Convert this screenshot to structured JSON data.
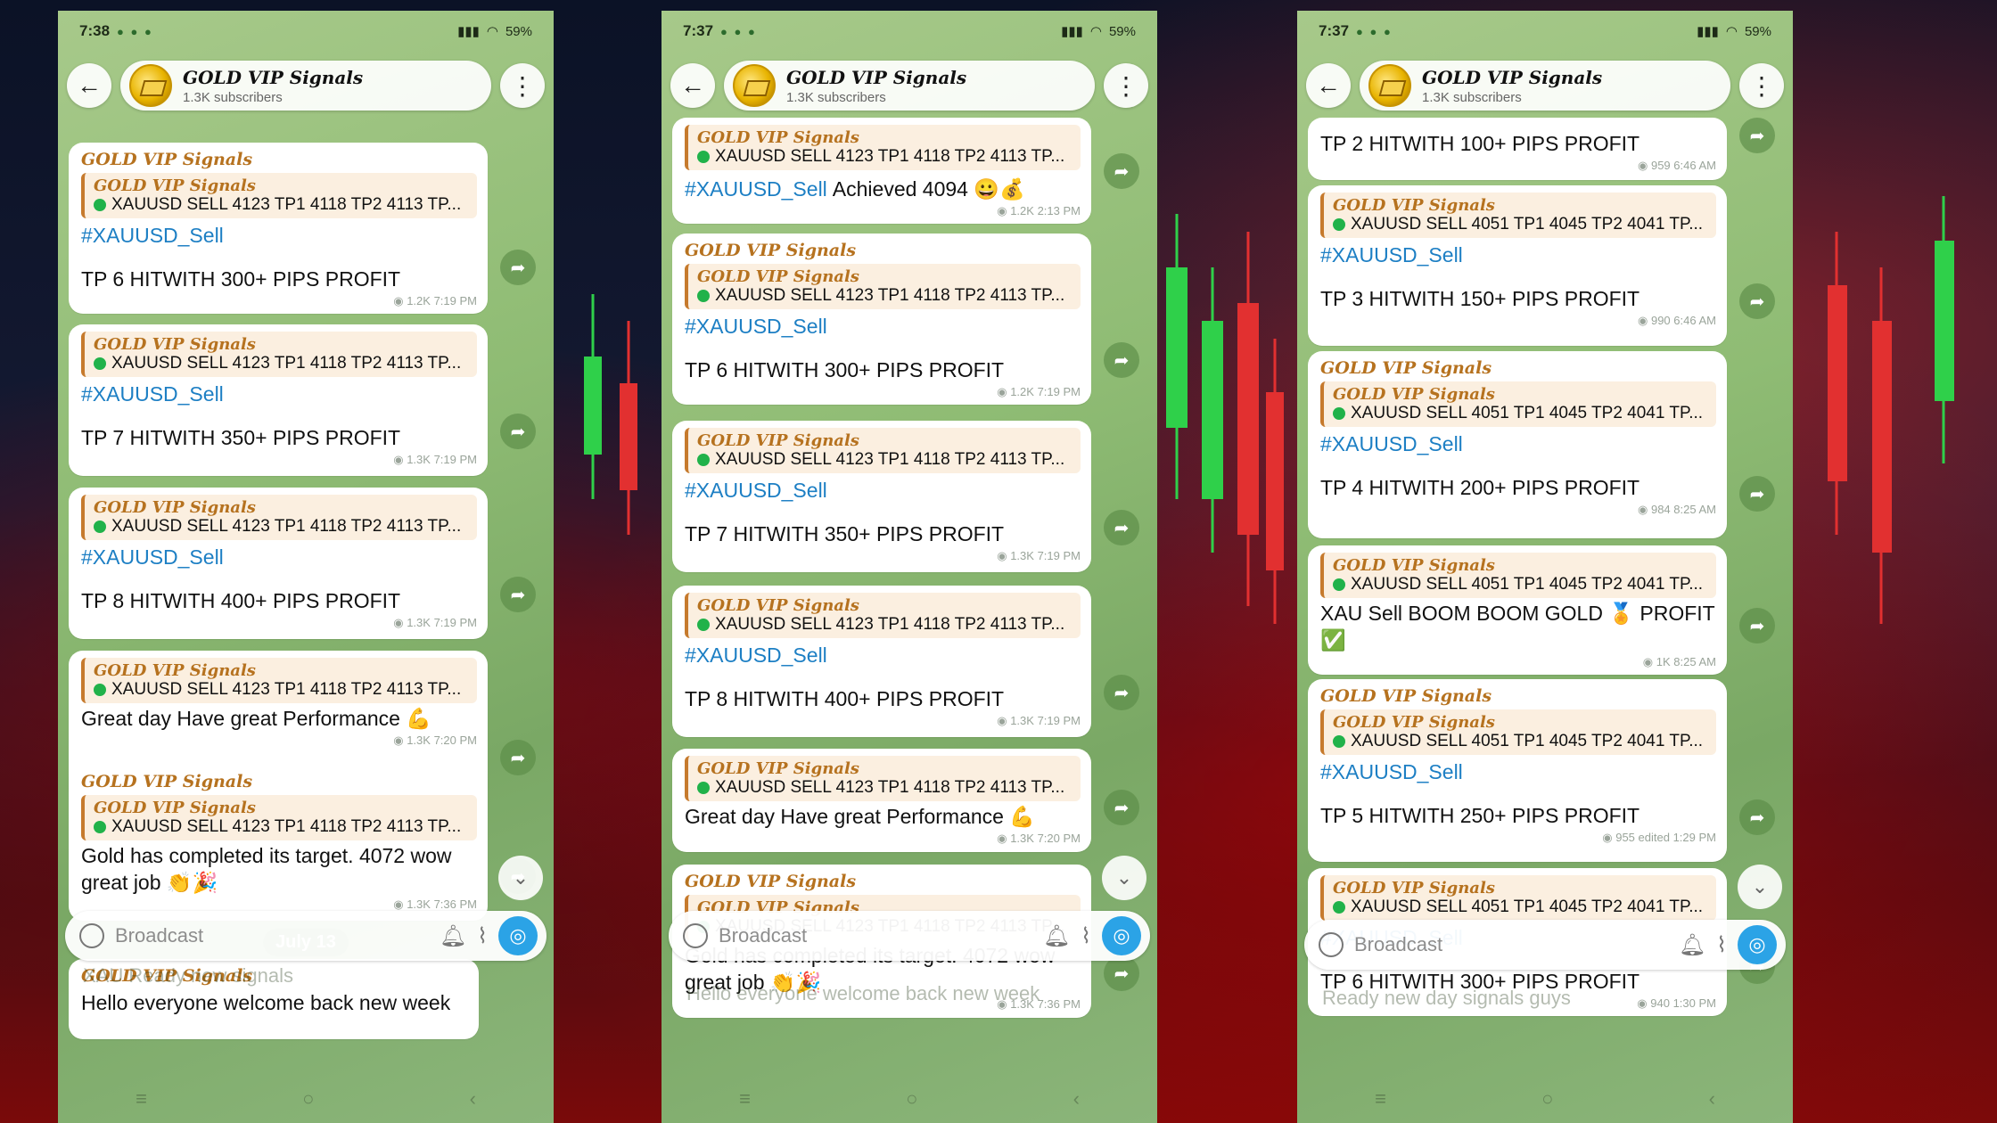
{
  "channel": {
    "title": "GOLD VIP Signals",
    "subscribers": "1.3K subscribers"
  },
  "composer": {
    "placeholder": "Broadcast"
  },
  "signal_4123": "XAUUSD SELL 4123  TP1 4118 TP2 4113 TP...",
  "signal_4051": "XAUUSD SELL 4051  TP1 4045 TP2 4041 TP...",
  "phones": [
    {
      "time": "7:38",
      "battery": "59%",
      "messages": [
        {
          "fwd": false,
          "quote": true,
          "tag": "#XAUUSD_Sell",
          "text": "TP 6 HITWITH 300+ PIPS PROFIT",
          "views": "1.2K",
          "time": "7:19 PM"
        },
        {
          "fwd": false,
          "quote": true,
          "tag": "#XAUUSD_Sell",
          "text": "TP 7 HITWITH 350+ PIPS PROFIT",
          "views": "1.3K",
          "time": "7:19 PM"
        },
        {
          "fwd": false,
          "quote": true,
          "tag": "#XAUUSD_Sell",
          "text": "TP 8 HITWITH 400+ PIPS PROFIT",
          "views": "1.3K",
          "time": "7:19 PM"
        },
        {
          "fwd": false,
          "quote": true,
          "tag": "",
          "text": "Great day Have great Performance 💪",
          "views": "1.3K",
          "time": "7:20 PM"
        },
        {
          "fwd": true,
          "quote": true,
          "tag": "",
          "text": "Gold has completed its target. 4072  wow great job 👏🎉",
          "views": "1.3K",
          "time": "7:36 PM"
        }
      ],
      "date_pill": "July 13",
      "last_message": "Hello everyone welcome back new week",
      "under_text": "XAU Ready new signals"
    },
    {
      "time": "7:37",
      "battery": "59%",
      "messages": [
        {
          "fwd": false,
          "quote": true,
          "tag": "#XAUUSD_Sell",
          "text": "Achieved 4094 😀💰",
          "views": "1.2K",
          "time": "2:13 PM"
        },
        {
          "fwd": true,
          "quote": true,
          "tag": "#XAUUSD_Sell",
          "text": "TP 6 HITWITH 300+ PIPS PROFIT",
          "views": "1.2K",
          "time": "7:19 PM"
        },
        {
          "fwd": false,
          "quote": true,
          "tag": "#XAUUSD_Sell",
          "text": "TP 7 HITWITH 350+ PIPS PROFIT",
          "views": "1.3K",
          "time": "7:19 PM"
        },
        {
          "fwd": false,
          "quote": true,
          "tag": "#XAUUSD_Sell",
          "text": "TP 8 HITWITH 400+ PIPS PROFIT",
          "views": "1.3K",
          "time": "7:19 PM"
        },
        {
          "fwd": false,
          "quote": true,
          "tag": "",
          "text": "Great day Have great Performance 💪",
          "views": "1.3K",
          "time": "7:20 PM"
        },
        {
          "fwd": true,
          "quote": true,
          "tag": "",
          "text": "Gold has completed its target. 4072  wow great job 👏🎉",
          "views": "1.3K",
          "time": "7:36 PM"
        }
      ],
      "under_text": "Hello everyone welcome back new week"
    },
    {
      "time": "7:37",
      "battery": "59%",
      "messages": [
        {
          "fwd": false,
          "quote": false,
          "tag": "",
          "text": "TP 2 HITWITH 100+ PIPS PROFIT",
          "views": "959",
          "time": "6:46 AM"
        },
        {
          "fwd": false,
          "quote": true,
          "tag": "#XAUUSD_Sell",
          "text": "TP 3 HITWITH 150+ PIPS PROFIT",
          "views": "990",
          "time": "6:46 AM"
        },
        {
          "fwd": true,
          "quote": true,
          "tag": "#XAUUSD_Sell",
          "text": "TP 4 HITWITH 200+ PIPS PROFIT",
          "views": "984",
          "time": "8:25 AM"
        },
        {
          "fwd": false,
          "quote": true,
          "tag": "",
          "text": "XAU Sell BOOM BOOM GOLD 🏅  PROFIT ✅",
          "views": "1K",
          "time": "8:25 AM"
        },
        {
          "fwd": true,
          "quote": true,
          "tag": "#XAUUSD_Sell",
          "text": "TP 5 HITWITH 250+ PIPS PROFIT",
          "views": "955",
          "time": "edited 1:29 PM"
        },
        {
          "fwd": false,
          "quote": true,
          "tag": "#XAUUSD_Sell",
          "text": "TP 6 HITWITH 300+ PIPS PROFIT",
          "views": "940",
          "time": "1:30 PM"
        }
      ],
      "under_text": "Ready new day signals guys"
    }
  ]
}
